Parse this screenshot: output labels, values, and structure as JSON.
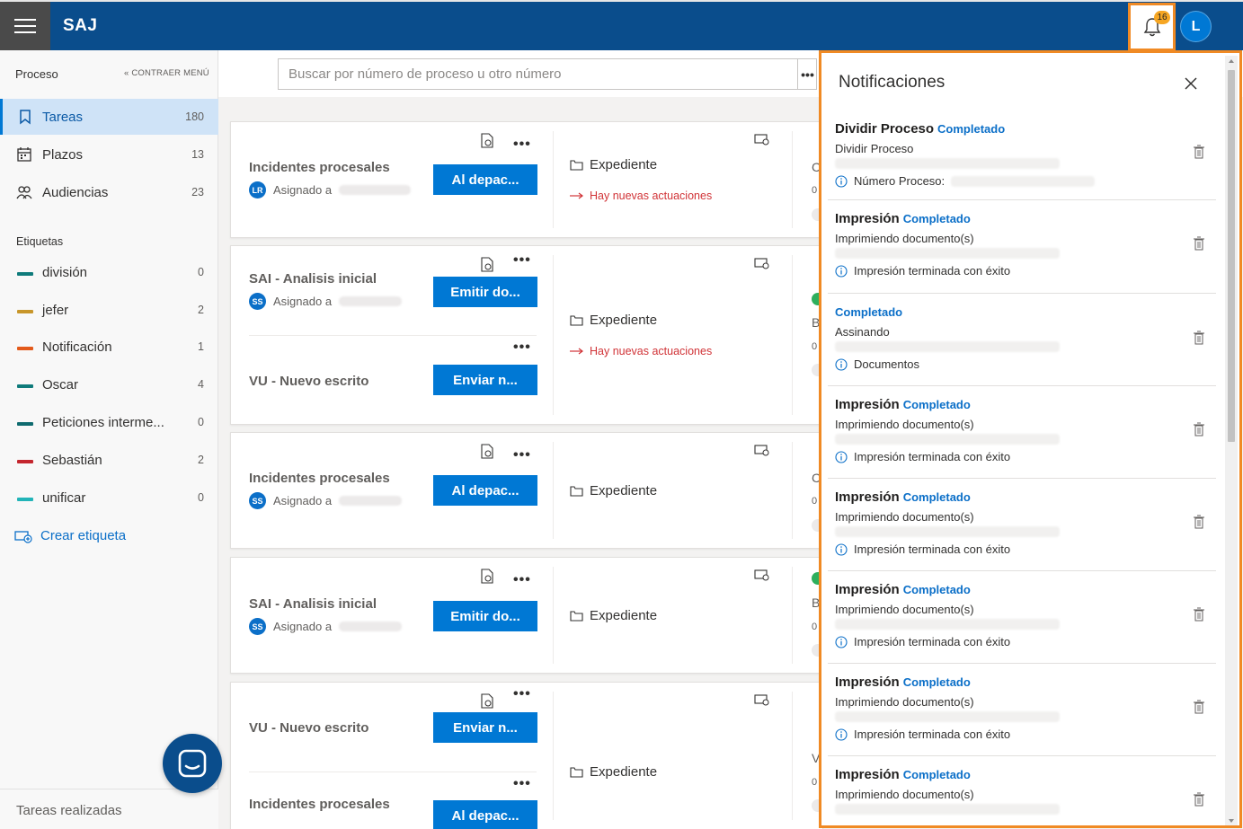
{
  "app": {
    "title": "SAJ",
    "notifications_count": "16",
    "user_initial": "L"
  },
  "sidebar": {
    "header": "Proceso",
    "collapse_label": "CONTRAER MENÚ",
    "nav": [
      {
        "label": "Tareas",
        "count": "180",
        "icon": "bookmark-icon"
      },
      {
        "label": "Plazos",
        "count": "13",
        "icon": "calendar-icon"
      },
      {
        "label": "Audiencias",
        "count": "23",
        "icon": "people-icon"
      }
    ],
    "tags_header": "Etiquetas",
    "tags": [
      {
        "label": "división",
        "count": "0",
        "color": "#0f7b7b"
      },
      {
        "label": "jefer",
        "count": "2",
        "color": "#c8962a"
      },
      {
        "label": "Notificación",
        "count": "1",
        "color": "#e35a1b"
      },
      {
        "label": "Oscar",
        "count": "4",
        "color": "#0f7b7b"
      },
      {
        "label": "Peticiones interme...",
        "count": "0",
        "color": "#0f6b6f"
      },
      {
        "label": "Sebastián",
        "count": "2",
        "color": "#c4262e"
      },
      {
        "label": "unificar",
        "count": "0",
        "color": "#22b4b8"
      }
    ],
    "create_tag": "Crear etiqueta",
    "footer": "Tareas realizadas"
  },
  "search": {
    "placeholder": "Buscar por número de proceso u otro número",
    "more": "•••"
  },
  "cards": {
    "c1": {
      "task1": "Incidentes procesales",
      "initials1": "LR",
      "assigned": "Asignado a",
      "btn1": "Al depac...",
      "exp": "Expediente",
      "alert": "Hay nuevas actuaciones",
      "col3a": "C",
      "col3b": "0"
    },
    "c2": {
      "task1": "SAI - Analisis inicial",
      "initials1": "SS",
      "assigned": "Asignado a",
      "btn1": "Emitir do...",
      "task2": "VU - Nuevo escrito",
      "btn2": "Enviar n...",
      "exp": "Expediente",
      "alert": "Hay nuevas actuaciones",
      "col3a": "B",
      "col3b": "0"
    },
    "c3": {
      "task1": "Incidentes procesales",
      "initials1": "SS",
      "assigned": "Asignado a",
      "btn1": "Al depac...",
      "exp": "Expediente",
      "col3a": "C",
      "col3b": "0"
    },
    "c4": {
      "task1": "SAI - Analisis inicial",
      "initials1": "SS",
      "assigned": "Asignado a",
      "btn1": "Emitir do...",
      "exp": "Expediente",
      "col3a": "B",
      "col3b": "0"
    },
    "c5": {
      "task1": "VU - Nuevo escrito",
      "btn1": "Enviar n...",
      "task2": "Incidentes procesales",
      "btn2": "Al depac...",
      "exp": "Expediente",
      "col3a": "V",
      "col3b": "0"
    }
  },
  "panel": {
    "title": "Notificaciones",
    "items": [
      {
        "title": "Dividir Proceso",
        "status": "Completado",
        "subtitle": "Dividir Proceso",
        "info": "Número Proceso:"
      },
      {
        "title": "Impresión",
        "status": "Completado",
        "subtitle": "Imprimiendo documento(s)",
        "info": "Impresión terminada con éxito"
      },
      {
        "title": "",
        "status": "Completado",
        "subtitle": "Assinando",
        "info": "Documentos"
      },
      {
        "title": "Impresión",
        "status": "Completado",
        "subtitle": "Imprimiendo documento(s)",
        "info": "Impresión terminada con éxito"
      },
      {
        "title": "Impresión",
        "status": "Completado",
        "subtitle": "Imprimiendo documento(s)",
        "info": "Impresión terminada con éxito"
      },
      {
        "title": "Impresión",
        "status": "Completado",
        "subtitle": "Imprimiendo documento(s)",
        "info": "Impresión terminada con éxito"
      },
      {
        "title": "Impresión",
        "status": "Completado",
        "subtitle": "Imprimiendo documento(s)",
        "info": "Impresión terminada con éxito"
      },
      {
        "title": "Impresión",
        "status": "Completado",
        "subtitle": "Imprimiendo documento(s)",
        "info": ""
      }
    ]
  },
  "colors": {
    "brand": "#0a4d8c",
    "accent": "#0078d4",
    "highlight": "#f08a24",
    "alert": "#d13438"
  }
}
